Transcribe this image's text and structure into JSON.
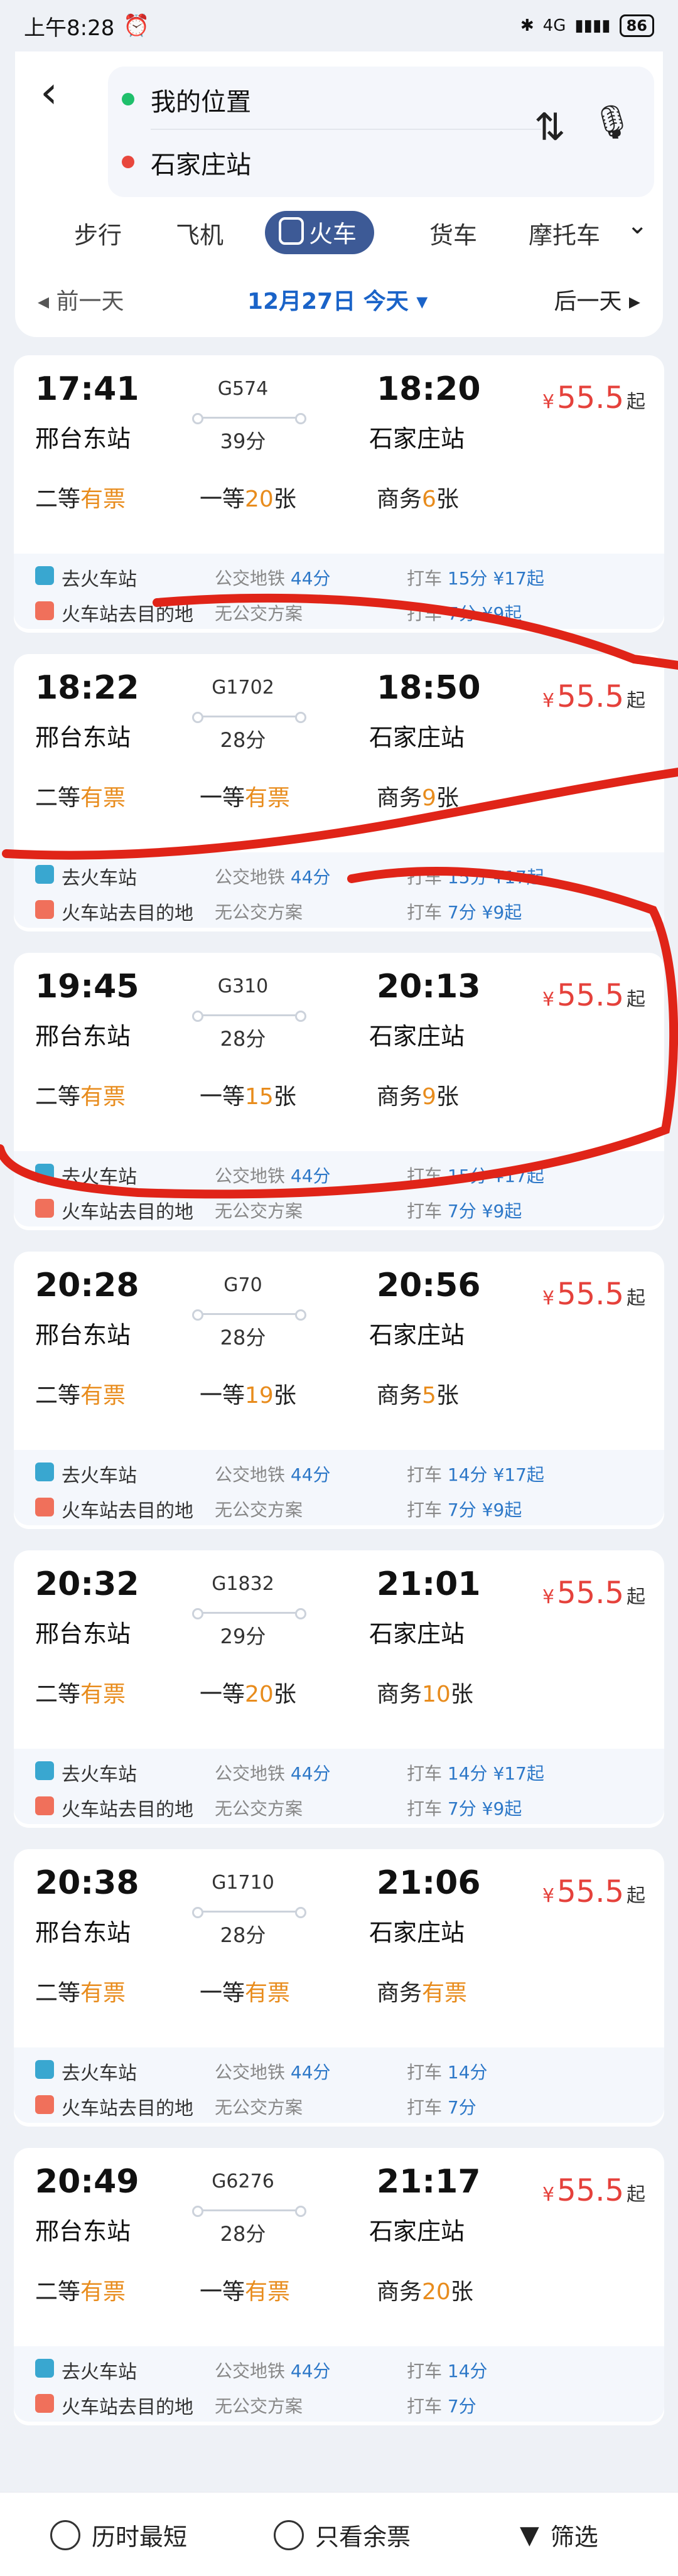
{
  "status": {
    "time": "上午8:28",
    "signal": "4G",
    "battery": "86"
  },
  "route": {
    "from": "我的位置",
    "to": "石家庄站"
  },
  "modes": {
    "walk": "步行",
    "plane": "飞机",
    "train": "火车",
    "truck": "货车",
    "moto": "摩托车",
    "more": "⌄"
  },
  "dates": {
    "prev": "◂ 前一天",
    "current": "12月27日 今天 ▾",
    "next": "后一天 ▸"
  },
  "trains": [
    {
      "dep": "17:41",
      "arr": "18:20",
      "no": "G574",
      "dur": "39分",
      "from": "邢台东站",
      "to": "石家庄站",
      "price": "55.5",
      "s1": "二等",
      "v1": "有票",
      "s2": "一等",
      "v2": "20",
      "u2": "张",
      "s3": "商务",
      "v3": "6",
      "u3": "张",
      "t1": "去火车站",
      "t1m": "公交地铁",
      "t1mv": "44分",
      "t1r": "打车",
      "t1rv": "15分",
      "t1rp": "¥17起",
      "t2": "火车站去目的地",
      "t2m": "无公交方案",
      "t2r": "打车",
      "t2rv": "7分",
      "t2rp": "¥9起"
    },
    {
      "dep": "18:22",
      "arr": "18:50",
      "no": "G1702",
      "dur": "28分",
      "from": "邢台东站",
      "to": "石家庄站",
      "price": "55.5",
      "s1": "二等",
      "v1": "有票",
      "s2": "一等",
      "v2": "有票",
      "u2": "",
      "s3": "商务",
      "v3": "9",
      "u3": "张",
      "t1": "去火车站",
      "t1m": "公交地铁",
      "t1mv": "44分",
      "t1r": "打车",
      "t1rv": "15分",
      "t1rp": "¥17起",
      "t2": "火车站去目的地",
      "t2m": "无公交方案",
      "t2r": "打车",
      "t2rv": "7分",
      "t2rp": "¥9起"
    },
    {
      "dep": "19:45",
      "arr": "20:13",
      "no": "G310",
      "dur": "28分",
      "from": "邢台东站",
      "to": "石家庄站",
      "price": "55.5",
      "s1": "二等",
      "v1": "有票",
      "s2": "一等",
      "v2": "15",
      "u2": "张",
      "s3": "商务",
      "v3": "9",
      "u3": "张",
      "t1": "去火车站",
      "t1m": "公交地铁",
      "t1mv": "44分",
      "t1r": "打车",
      "t1rv": "15分",
      "t1rp": "¥17起",
      "t2": "火车站去目的地",
      "t2m": "无公交方案",
      "t2r": "打车",
      "t2rv": "7分",
      "t2rp": "¥9起"
    },
    {
      "dep": "20:28",
      "arr": "20:56",
      "no": "G70",
      "dur": "28分",
      "from": "邢台东站",
      "to": "石家庄站",
      "price": "55.5",
      "s1": "二等",
      "v1": "有票",
      "s2": "一等",
      "v2": "19",
      "u2": "张",
      "s3": "商务",
      "v3": "5",
      "u3": "张",
      "t1": "去火车站",
      "t1m": "公交地铁",
      "t1mv": "44分",
      "t1r": "打车",
      "t1rv": "14分",
      "t1rp": "¥17起",
      "t2": "火车站去目的地",
      "t2m": "无公交方案",
      "t2r": "打车",
      "t2rv": "7分",
      "t2rp": "¥9起"
    },
    {
      "dep": "20:32",
      "arr": "21:01",
      "no": "G1832",
      "dur": "29分",
      "from": "邢台东站",
      "to": "石家庄站",
      "price": "55.5",
      "s1": "二等",
      "v1": "有票",
      "s2": "一等",
      "v2": "20",
      "u2": "张",
      "s3": "商务",
      "v3": "10",
      "u3": "张",
      "t1": "去火车站",
      "t1m": "公交地铁",
      "t1mv": "44分",
      "t1r": "打车",
      "t1rv": "14分",
      "t1rp": "¥17起",
      "t2": "火车站去目的地",
      "t2m": "无公交方案",
      "t2r": "打车",
      "t2rv": "7分",
      "t2rp": "¥9起"
    },
    {
      "dep": "20:38",
      "arr": "21:06",
      "no": "G1710",
      "dur": "28分",
      "from": "邢台东站",
      "to": "石家庄站",
      "price": "55.5",
      "s1": "二等",
      "v1": "有票",
      "s2": "一等",
      "v2": "有票",
      "u2": "",
      "s3": "商务",
      "v3": "有票",
      "u3": "",
      "t1": "去火车站",
      "t1m": "公交地铁",
      "t1mv": "44分",
      "t1r": "打车",
      "t1rv": "14分",
      "t1rp": "",
      "t2": "火车站去目的地",
      "t2m": "无公交方案",
      "t2r": "打车",
      "t2rv": "7分",
      "t2rp": ""
    },
    {
      "dep": "20:49",
      "arr": "21:17",
      "no": "G6276",
      "dur": "28分",
      "from": "邢台东站",
      "to": "石家庄站",
      "price": "55.5",
      "s1": "二等",
      "v1": "有票",
      "s2": "一等",
      "v2": "有票",
      "u2": "",
      "s3": "商务",
      "v3": "20",
      "u3": "张",
      "t1": "去火车站",
      "t1m": "公交地铁",
      "t1mv": "44分",
      "t1r": "打车",
      "t1rv": "14分",
      "t1rp": "",
      "t2": "火车站去目的地",
      "t2m": "无公交方案",
      "t2r": "打车",
      "t2rv": "7分",
      "t2rp": ""
    }
  ],
  "bottom": {
    "opt1": "历时最短",
    "opt2": "只看余票",
    "filter": "筛选"
  },
  "currency": "¥",
  "from_label": "起"
}
